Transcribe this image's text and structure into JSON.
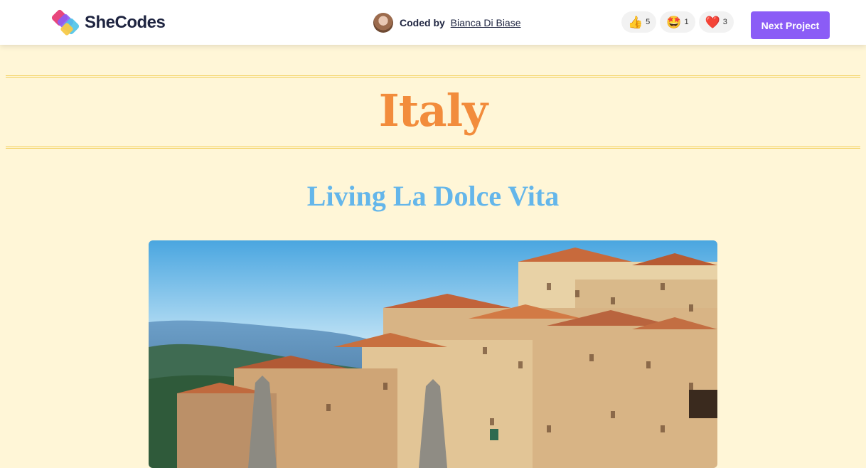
{
  "header": {
    "brand": "SheCodes",
    "coded_by_prefix": "Coded by",
    "author": "Bianca Di Biase",
    "reactions": [
      {
        "icon": "thumbs-up-icon",
        "emoji": "👍",
        "count": "5"
      },
      {
        "icon": "star-struck-icon",
        "emoji": "🤩",
        "count": "1"
      },
      {
        "icon": "heart-icon",
        "emoji": "❤️",
        "count": "3"
      }
    ],
    "next_label": "Next Project"
  },
  "main": {
    "title": "Italy",
    "subtitle": "Living La Dolce Vita",
    "hero_image": "italian-hill-town-photo"
  },
  "colors": {
    "page_bg": "#fff6d7",
    "title": "#f28c3c",
    "subtitle": "#64b6ea",
    "accent_button": "#8b5cf6",
    "rule": "#f2cf5a"
  }
}
